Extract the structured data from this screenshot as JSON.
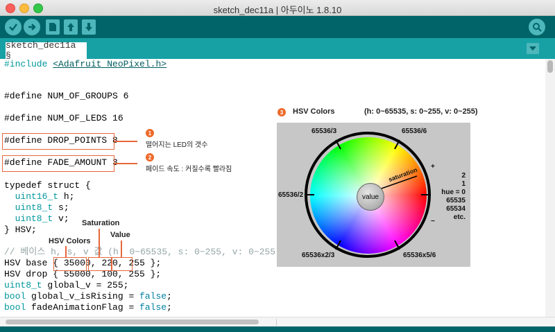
{
  "window": {
    "title": "sketch_dec11a | 아두이노 1.8.10"
  },
  "toolbar": {
    "verify_icon": "check-icon",
    "upload_icon": "arrow-right-icon",
    "new_icon": "new-file-icon",
    "open_icon": "arrow-up-icon",
    "save_icon": "arrow-down-icon",
    "serial_icon": "magnifier-icon"
  },
  "tab": {
    "label": "sketch_dec11a §"
  },
  "code": {
    "l1_kw": "#include ",
    "l1_str": "<Adafruit_NeoPixel.h>",
    "l2": "#define NUM_OF_GROUPS 6",
    "l3": "#define NUM_OF_LEDS 16",
    "l4": "#define DROP_POINTS 8",
    "l5": "#define FADE_AMOUNT 3",
    "l6": "typedef struct {",
    "l7_kw": "  uint16_t",
    "l7_rest": " h;",
    "l8_kw": "  uint8_t",
    "l8_rest": " s;",
    "l9_kw": "  uint8_t",
    "l9_rest": " v;",
    "l10": "} HSV;",
    "l11": "// 베이스 h, s, v 값 (h: 0~65535, s: 0~255, v: 0~255)",
    "l12_a": "HSV base { ",
    "l12_b": "35000",
    "l12_c": ", ",
    "l12_d": "220",
    "l12_e": ", ",
    "l12_f": "255",
    "l12_g": " };",
    "l13": "HSV drop { 55000, 100, 255 };",
    "l14_kw": "uint8_t",
    "l14_rest": " global_v = 255;",
    "l15_kw": "bool",
    "l15_mid": " global_v_isRising = ",
    "l15_val": "false",
    "l15_end": ";",
    "l16_kw": "bool",
    "l16_mid": " fadeAnimationFlag = ",
    "l16_val": "false",
    "l16_end": ";"
  },
  "annotations": {
    "badge1": "1",
    "text1": "떨어지는 LED의 갯수",
    "badge2": "2",
    "text2": "페이드 속도 : 커질수록 빨라짐",
    "badge3": "3",
    "hsv_title": "HSV Colors",
    "hsv_range": "(h: 0~65535, s: 0~255, v: 0~255)",
    "saturation": "Saturation",
    "value": "Value",
    "hsv_colors": "HSV Colors"
  },
  "wheel": {
    "top_left": "65536/3",
    "top_right": "65536/6",
    "left": "65536/2",
    "bottom_left": "65536x2/3",
    "bottom_right": "65536x5/6",
    "right_list": [
      "2",
      "1",
      "hue = 0",
      "65535",
      "65534",
      "etc."
    ],
    "center": "value",
    "saturation": "saturation",
    "plus": "+",
    "minus": "−"
  },
  "colors": {
    "accent": "#e8663a",
    "toolbar": "#006468",
    "tabbar": "#17a1a5"
  }
}
